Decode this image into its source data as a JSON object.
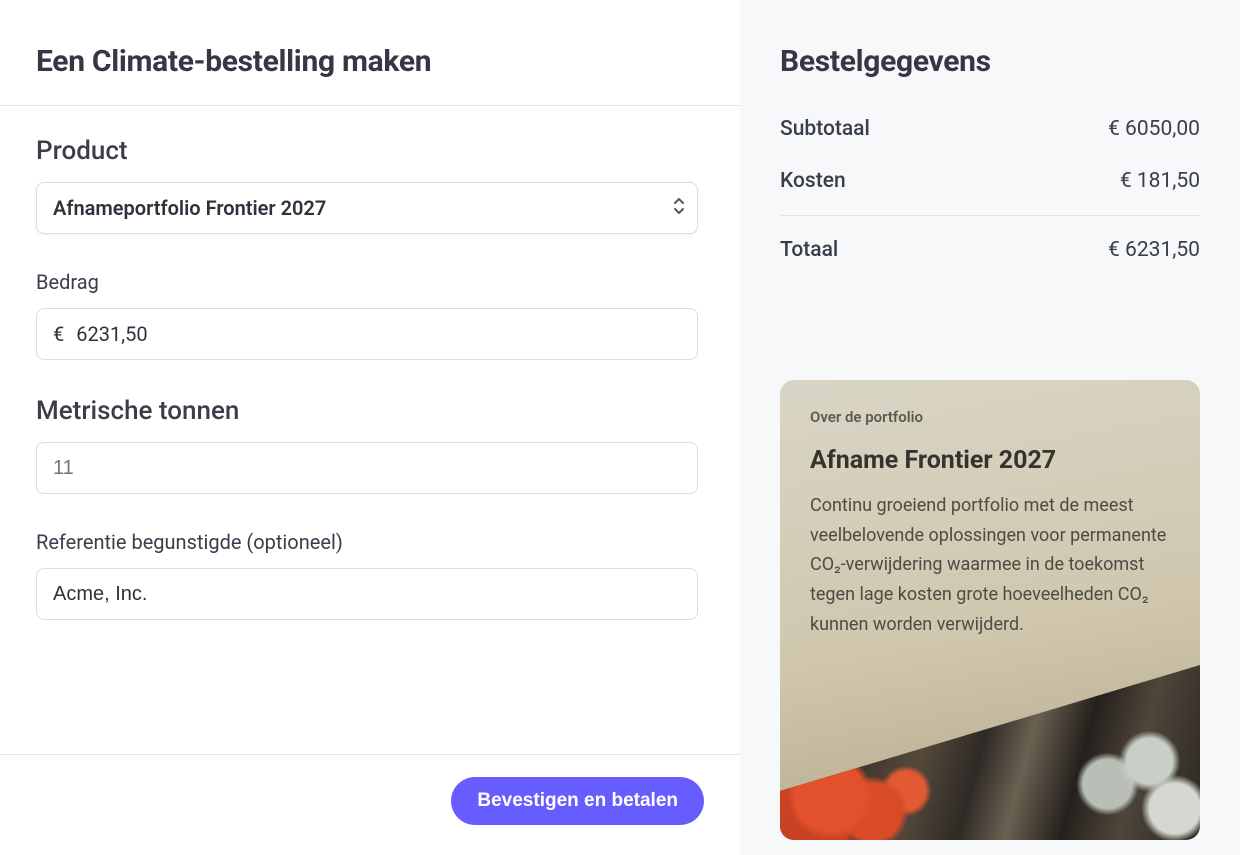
{
  "header": {
    "title": "Een Climate-bestelling maken"
  },
  "form": {
    "product": {
      "label": "Product",
      "selected": "Afnameportfolio Frontier 2027"
    },
    "amount": {
      "label": "Bedrag",
      "currency_symbol": "€",
      "value": "6231,50"
    },
    "metric_tons": {
      "label": "Metrische tonnen",
      "placeholder": "11",
      "value": ""
    },
    "reference": {
      "label": "Referentie begunstigde (optioneel)",
      "value": "Acme, Inc."
    }
  },
  "footer": {
    "confirm_label": "Bevestigen en betalen"
  },
  "summary": {
    "title": "Bestelgegevens",
    "rows": {
      "subtotal": {
        "label": "Subtotaal",
        "value": "€ 6050,00"
      },
      "fees": {
        "label": "Kosten",
        "value": "€ 181,50"
      },
      "total": {
        "label": "Totaal",
        "value": "€ 6231,50"
      }
    }
  },
  "portfolio_card": {
    "eyebrow": "Over de portfolio",
    "heading": "Afname Frontier 2027",
    "description": "Continu groeiend portfolio met de meest veelbelovende oplossingen voor permanente CO₂-verwijdering waarmee in de toekomst tegen lage kosten grote hoeveelheden CO₂ kunnen worden verwijderd."
  }
}
